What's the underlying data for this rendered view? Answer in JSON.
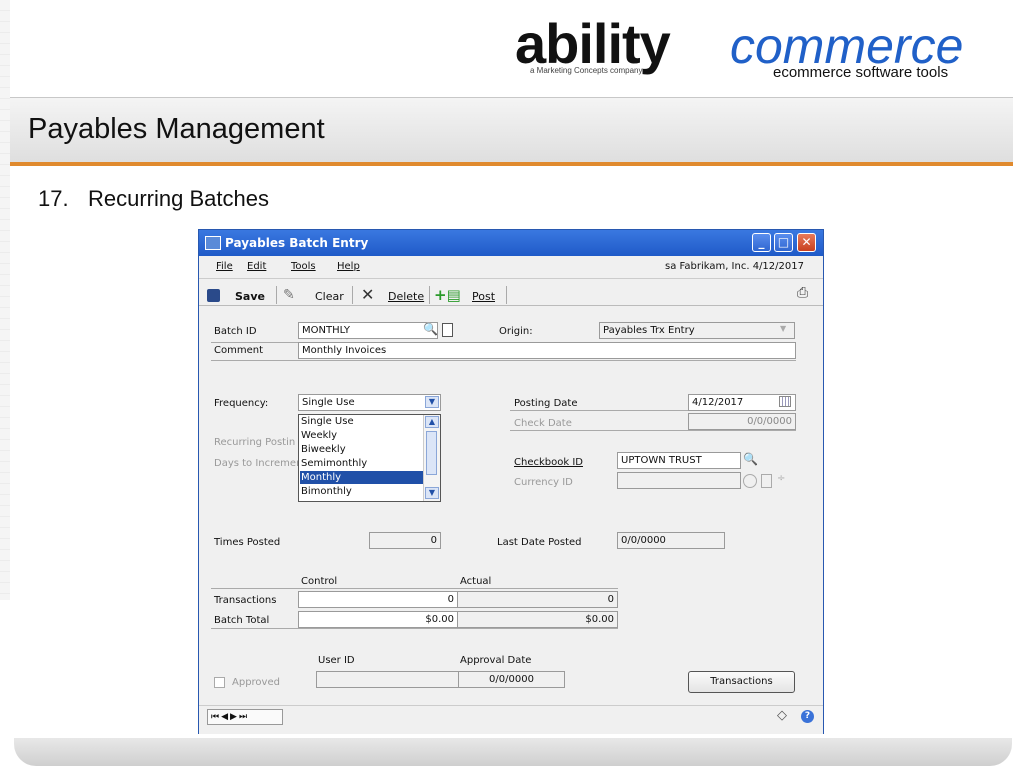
{
  "slide": {
    "logo": {
      "brand": "ability",
      "brand2": "commerce",
      "tagline": "a Marketing Concepts company",
      "subtitle": "ecommerce software tools"
    },
    "title": "Payables Management",
    "section": {
      "number": "17.",
      "title": "Recurring Batches"
    }
  },
  "dialog": {
    "title": "Payables Batch Entry",
    "menu": [
      "File",
      "Edit",
      "Tools",
      "Help"
    ],
    "status_info": "sa  Fabrikam, Inc.  4/12/2017",
    "toolbar": {
      "save": "Save",
      "clear": "Clear",
      "delete": "Delete",
      "post": "Post"
    },
    "form": {
      "batch_id_label": "Batch ID",
      "batch_id_value": "MONTHLY",
      "origin_label": "Origin:",
      "origin_value": "Payables Trx Entry",
      "comment_label": "Comment",
      "comment_value": "Monthly Invoices",
      "frequency_label": "Frequency:",
      "frequency_value": "Single Use",
      "frequency_options": [
        "Single Use",
        "Weekly",
        "Biweekly",
        "Semimonthly",
        "Monthly",
        "Bimonthly"
      ],
      "frequency_highlighted": "Monthly",
      "recurring_posting_label": "Recurring Postin",
      "days_to_increment_label": "Days to Incremen",
      "posting_date_label": "Posting Date",
      "posting_date_value": "4/12/2017",
      "check_date_label": "Check Date",
      "check_date_value": "0/0/0000",
      "checkbook_id_label": "Checkbook ID",
      "checkbook_id_value": "UPTOWN TRUST",
      "currency_id_label": "Currency ID",
      "times_posted_label": "Times Posted",
      "times_posted_value": "0",
      "last_date_posted_label": "Last Date Posted",
      "last_date_posted_value": "0/0/0000",
      "control_header": "Control",
      "actual_header": "Actual",
      "transactions_label": "Transactions",
      "transactions_control": "0",
      "transactions_actual": "0",
      "batch_total_label": "Batch Total",
      "batch_total_control": "$0.00",
      "batch_total_actual": "$0.00",
      "user_id_label": "User ID",
      "approval_date_label": "Approval Date",
      "approval_date_value": "0/0/0000",
      "approved_label": "Approved",
      "transactions_button": "Transactions"
    }
  }
}
